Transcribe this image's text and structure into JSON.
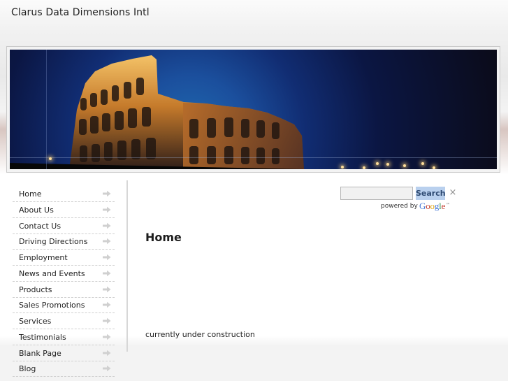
{
  "site": {
    "title": "Clarus Data Dimensions Intl"
  },
  "sidebar": {
    "items": [
      {
        "label": "Home",
        "icon": "arrow-right-icon"
      },
      {
        "label": "About Us",
        "icon": "arrow-right-icon"
      },
      {
        "label": "Contact Us",
        "icon": "arrow-right-icon"
      },
      {
        "label": "Driving Directions",
        "icon": "arrow-right-icon"
      },
      {
        "label": "Employment",
        "icon": "arrow-right-icon"
      },
      {
        "label": "News and Events",
        "icon": "arrow-right-icon"
      },
      {
        "label": "Products",
        "icon": "arrow-right-icon"
      },
      {
        "label": "Sales Promotions",
        "icon": "arrow-right-icon"
      },
      {
        "label": "Services",
        "icon": "arrow-right-icon"
      },
      {
        "label": "Testimonials",
        "icon": "arrow-right-icon"
      },
      {
        "label": "Blank Page",
        "icon": "arrow-right-icon"
      },
      {
        "label": "Blog",
        "icon": "arrow-right-icon"
      }
    ]
  },
  "search": {
    "value": "",
    "placeholder": "",
    "button_label": "Search",
    "close_label": "×",
    "powered_by": "powered by",
    "provider": "Google",
    "trademark": "™"
  },
  "main": {
    "title": "Home",
    "body": "currently under construction"
  },
  "colors": {
    "search_button": "#b9d0ee",
    "sidebar_divider": "#d7d7d7",
    "banner_sky": "#112d73"
  }
}
